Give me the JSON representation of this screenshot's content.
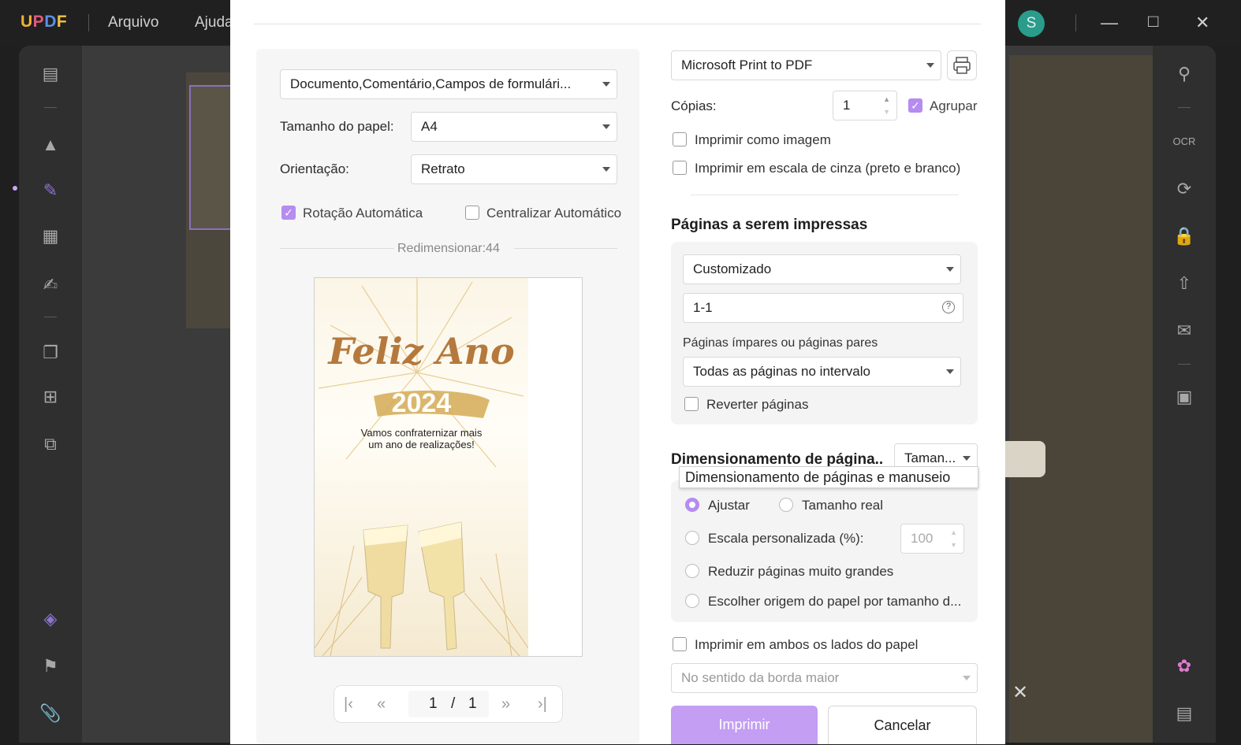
{
  "app": {
    "logo": "UPDF",
    "menu": [
      "Arquivo",
      "Ajuda"
    ],
    "avatar_letter": "S",
    "accent": "#b58cf0"
  },
  "dialog": {
    "content_select": "Documento,Comentário,Campos de formulári...",
    "paper_size_label": "Tamanho do papel:",
    "paper_size": "A4",
    "orientation_label": "Orientação:",
    "orientation": "Retrato",
    "auto_rotate_label": "Rotação Automática",
    "auto_rotate": true,
    "auto_center_label": "Centralizar Automático",
    "auto_center": false,
    "resize_label": "Redimensionar:44ʿ",
    "preview": {
      "title": "Feliz Ano",
      "year": "2024",
      "message_line1": "Vamos confraternizar mais",
      "message_line2": "um ano de realizações!"
    },
    "pager": {
      "current": "1",
      "sep": "/",
      "total": "1"
    },
    "printer": "Microsoft Print to PDF",
    "copies_label": "Cópias:",
    "copies": "1",
    "collate_label": "Agrupar",
    "collate": true,
    "print_as_image_label": "Imprimir como imagem",
    "grayscale_label": "Imprimir em escala de cinza (preto e branco)",
    "pages_heading": "Páginas a serem impressas",
    "pages_mode": "Customizado",
    "pages_range": "1-1",
    "odd_even_label": "Páginas ímpares ou páginas pares",
    "odd_even": "Todas as páginas no intervalo",
    "reverse_label": "Reverter páginas",
    "scaling_heading": "Dimensionamento de página..",
    "scaling_mode": "Taman...",
    "tooltip": "Dimensionamento de páginas e manuseio",
    "fit_label": "Ajustar",
    "actual_size_label": "Tamanho real",
    "custom_scale_label": "Escala personalizada (%):",
    "custom_scale_value": "100",
    "shrink_label": "Reduzir páginas muito grandes",
    "paper_source_label": "Escolher origem do papel por tamanho d...",
    "duplex_label": "Imprimir em ambos os lados do papel",
    "duplex_mode": "No sentido da borda maior",
    "print_button": "Imprimir",
    "cancel_button": "Cancelar"
  }
}
